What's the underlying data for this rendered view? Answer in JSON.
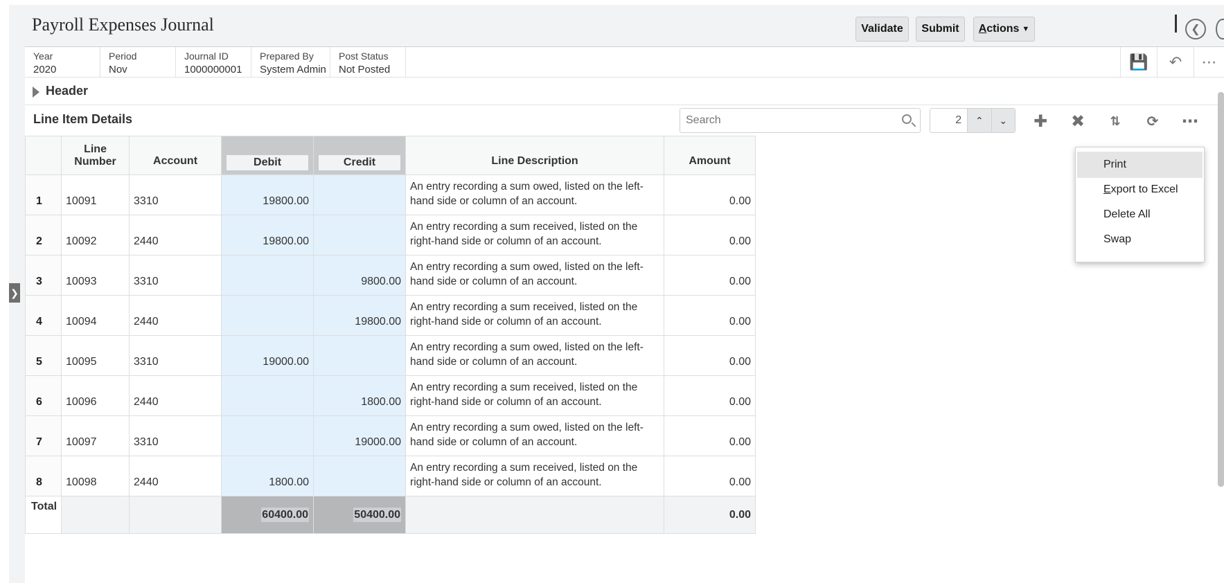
{
  "title": "Payroll Expenses Journal",
  "toolbar": {
    "validate": "Validate",
    "submit": "Submit",
    "actions_first": "A",
    "actions_rest": "ctions"
  },
  "info": [
    {
      "label": "Year",
      "value": "2020"
    },
    {
      "label": "Period",
      "value": "Nov"
    },
    {
      "label": "Journal ID",
      "value": "1000000001"
    },
    {
      "label": "Prepared By",
      "value": "System Admin"
    },
    {
      "label": "Post Status",
      "value": "Not Posted"
    }
  ],
  "header_section": "Header",
  "line_items": {
    "title": "Line Item Details",
    "search_placeholder": "Search",
    "spinner_value": "2",
    "columns": [
      "Line Number",
      "Account",
      "Debit",
      "Credit",
      "Line Description",
      "Amount"
    ],
    "rows": [
      {
        "row": "1",
        "line": "10091",
        "account": "3310",
        "debit": "19800.00",
        "credit": "",
        "desc": "An entry recording a sum owed, listed on the left-hand side or column of an account.",
        "amount": "0.00"
      },
      {
        "row": "2",
        "line": "10092",
        "account": "2440",
        "debit": "19800.00",
        "credit": "",
        "desc": "An entry recording a sum received, listed on the right-hand side or column of an account.",
        "amount": "0.00"
      },
      {
        "row": "3",
        "line": "10093",
        "account": "3310",
        "debit": "",
        "credit": "9800.00",
        "desc": "An entry recording a sum owed, listed on the left-hand side or column of an account.",
        "amount": "0.00"
      },
      {
        "row": "4",
        "line": "10094",
        "account": "2440",
        "debit": "",
        "credit": "19800.00",
        "desc": "An entry recording a sum received, listed on the right-hand side or column of an account.",
        "amount": "0.00"
      },
      {
        "row": "5",
        "line": "10095",
        "account": "3310",
        "debit": "19000.00",
        "credit": "",
        "desc": "An entry recording a sum owed, listed on the left-hand side or column of an account.",
        "amount": "0.00"
      },
      {
        "row": "6",
        "line": "10096",
        "account": "2440",
        "debit": "",
        "credit": "1800.00",
        "desc": "An entry recording a sum received, listed on the right-hand side or column of an account.",
        "amount": "0.00"
      },
      {
        "row": "7",
        "line": "10097",
        "account": "3310",
        "debit": "",
        "credit": "19000.00",
        "desc": "An entry recording a sum owed, listed on the left-hand side or column of an account.",
        "amount": "0.00"
      },
      {
        "row": "8",
        "line": "10098",
        "account": "2440",
        "debit": "1800.00",
        "credit": "",
        "desc": "An entry recording a sum received, listed on the right-hand side or column of an account.",
        "amount": "0.00"
      }
    ],
    "total": {
      "label": "Total",
      "debit": "60400.00",
      "credit": "50400.00",
      "amount": "0.00"
    }
  },
  "menu": {
    "print": "Print",
    "export_first": "E",
    "export_rest": "xport to Excel",
    "delete_all": "Delete All",
    "swap": "Swap"
  },
  "colors": {
    "selected_column": "#e3f1fc",
    "header_highlight": "#c7c9cb",
    "page_bg": "#f1f3f4"
  },
  "icons": [
    "back-circle-icon",
    "save-icon",
    "undo-icon",
    "overflow-icon",
    "search-icon",
    "chevron-up-icon",
    "chevron-down-icon",
    "add-icon",
    "delete-icon",
    "sort-icon",
    "refresh-icon",
    "more-icon",
    "expand-icon"
  ]
}
